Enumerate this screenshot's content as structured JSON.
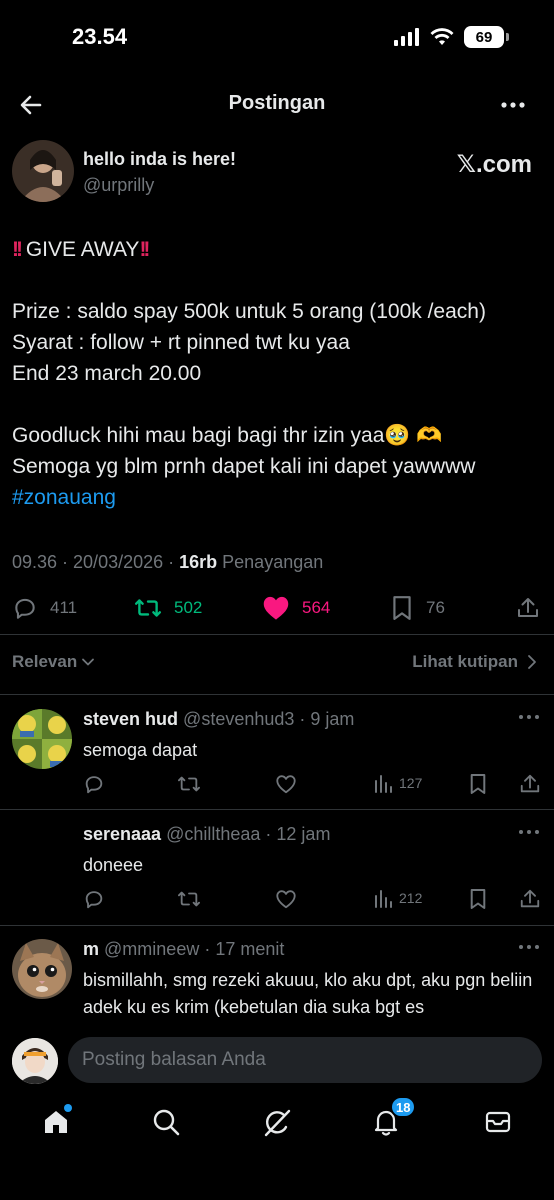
{
  "status": {
    "time": "23.54",
    "battery": "69"
  },
  "nav": {
    "title": "Postingan"
  },
  "post": {
    "author_name": "hello inda is here!",
    "author_handle": "@urprilly",
    "brand": "𝕏.com",
    "lines": {
      "l1": "GIVE AWAY",
      "l2": "Prize : saldo spay 500k untuk 5 orang (100k /each)",
      "l3": "Syarat : follow + rt pinned twt ku yaa",
      "l4": "End 23 march 20.00",
      "l5": "Goodluck hihi mau bagi bagi thr izin yaa🥹 🫶",
      "l6": "Semoga yg blm prnh dapet kali ini dapet yawwww",
      "hashtag": "#zonauang"
    },
    "timestamp": "09.36 · 20/03/2026 · ",
    "views_count": "16rb",
    "views_label": " Penayangan",
    "stats": {
      "replies": "411",
      "reposts": "502",
      "likes": "564",
      "bookmarks": "76"
    }
  },
  "filter": {
    "sort_label": "Relevan",
    "quotes_label": "Lihat kutipan"
  },
  "replies": [
    {
      "name": "steven hud",
      "handle": "@stevenhud3 · 9 jam",
      "text": "semoga dapat",
      "views": "127"
    },
    {
      "name": "serenaaa",
      "handle": "@chilltheaa · 12 jam",
      "text": "doneee",
      "views": "212"
    },
    {
      "name": "m",
      "handle": "@mmineew · 17 menit",
      "text": "bismillahh, smg rezeki akuuu, klo aku dpt, aku pgn beliin adek ku es krim (kebetulan dia suka bgt es"
    }
  ],
  "compose": {
    "placeholder": "Posting balasan Anda"
  },
  "tabbar": {
    "notif_badge": "18"
  },
  "colors": {
    "bg": "#000000",
    "text": "#e7e9ea",
    "muted": "#71767b",
    "accent": "#1d9bf0",
    "repost": "#00ba7c",
    "like": "#f91880"
  }
}
